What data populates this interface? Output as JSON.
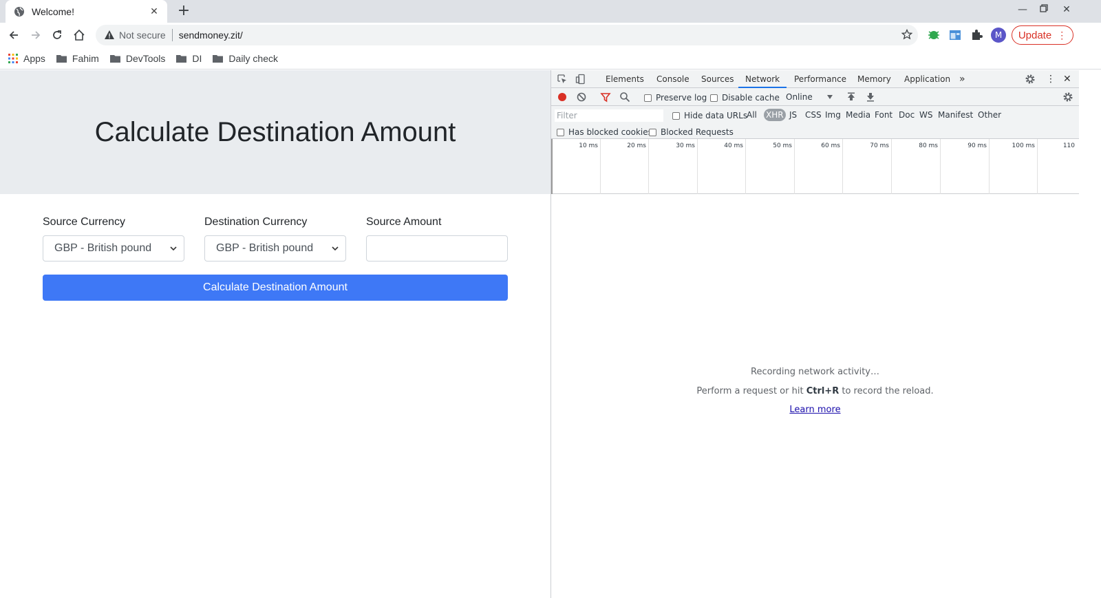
{
  "browser": {
    "tab_title": "Welcome!",
    "address": {
      "security_label": "Not secure",
      "url": "sendmoney.zit/"
    },
    "avatar_initial": "M",
    "update_label": "Update",
    "bookmarks": [
      "Apps",
      "Fahim",
      "DevTools",
      "DI",
      "Daily check"
    ]
  },
  "page": {
    "heading": "Calculate Destination Amount",
    "source_currency": {
      "label": "Source Currency",
      "value": "GBP - British pound"
    },
    "destination_currency": {
      "label": "Destination Currency",
      "value": "GBP - British pound"
    },
    "source_amount": {
      "label": "Source Amount",
      "value": ""
    },
    "submit_label": "Calculate Destination Amount"
  },
  "devtools": {
    "tabs": [
      "Elements",
      "Console",
      "Sources",
      "Network",
      "Performance",
      "Memory",
      "Application"
    ],
    "active_tab": "Network",
    "more_tabs": "»",
    "toolbar": {
      "preserve_log": "Preserve log",
      "disable_cache": "Disable cache",
      "throttle": "Online"
    },
    "filter": {
      "placeholder": "Filter",
      "hide_data_urls": "Hide data URLs",
      "types": [
        "All",
        "XHR",
        "JS",
        "CSS",
        "Img",
        "Media",
        "Font",
        "Doc",
        "WS",
        "Manifest",
        "Other"
      ],
      "selected_type": "XHR",
      "has_blocked_cookies": "Has blocked cookies",
      "blocked_requests": "Blocked Requests"
    },
    "timeline_ticks": [
      "10 ms",
      "20 ms",
      "30 ms",
      "40 ms",
      "50 ms",
      "60 ms",
      "70 ms",
      "80 ms",
      "90 ms",
      "100 ms",
      "110"
    ],
    "empty_state": {
      "line1": "Recording network activity…",
      "line2_pre": "Perform a request or hit ",
      "line2_key": "Ctrl+R",
      "line2_post": " to record the reload.",
      "learn_more": "Learn more"
    }
  },
  "colors": {
    "primary_button": "#3e78f6",
    "jumbotron_bg": "#e9ecef",
    "record_red": "#d93025",
    "update_red": "#d93025",
    "devtools_active": "#1a73e8"
  }
}
